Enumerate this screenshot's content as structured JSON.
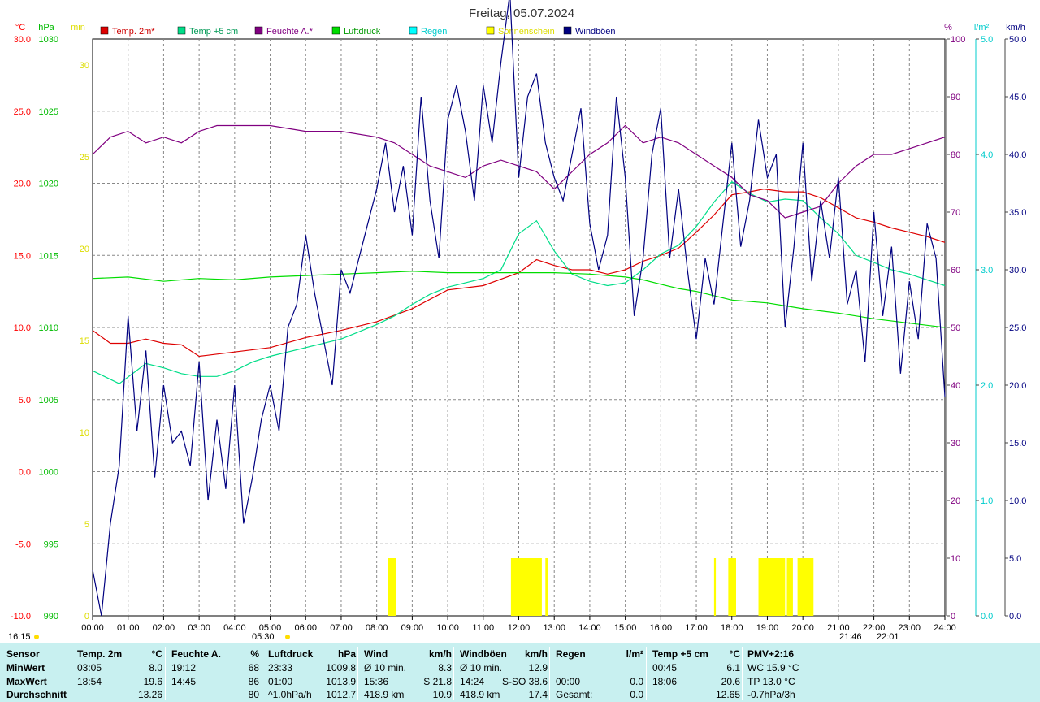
{
  "chart_data": {
    "type": "line",
    "title": "Freitag, 05.07.2024",
    "x_tick_labels": [
      "00:00",
      "01:00",
      "02:00",
      "03:00",
      "04:00",
      "05:00",
      "06:00",
      "07:00",
      "08:00",
      "09:00",
      "10:00",
      "11:00",
      "12:00",
      "13:00",
      "14:00",
      "15:00",
      "16:00",
      "17:00",
      "18:00",
      "19:00",
      "20:00",
      "21:00",
      "22:00",
      "23:00",
      "24:00"
    ],
    "grid": true,
    "axes": {
      "temp": {
        "unit": "°C",
        "color": "#ff0000",
        "range": [
          -10.0,
          30.0
        ],
        "ticks": [
          "30.0",
          "25.0",
          "20.0",
          "15.0",
          "10.0",
          "5.0",
          "0.0",
          "-5.0",
          "-10.0"
        ]
      },
      "pressure": {
        "unit": "hPa",
        "color": "#00bb00",
        "range": [
          990,
          1030
        ],
        "ticks": [
          "1030",
          "1025",
          "1020",
          "1015",
          "1010",
          "1005",
          "1000",
          "995",
          "990"
        ]
      },
      "sun_min": {
        "unit": "min",
        "color": "#dddd00",
        "range": [
          0,
          30
        ],
        "ticks": [
          "30",
          "25",
          "20",
          "15",
          "10",
          "5",
          "0"
        ]
      },
      "humidity": {
        "unit": "%",
        "color": "#800080",
        "range": [
          0,
          100
        ],
        "ticks": [
          "100",
          "90",
          "80",
          "70",
          "60",
          "50",
          "40",
          "30",
          "20",
          "10",
          "0"
        ]
      },
      "rain": {
        "unit": "l/m²",
        "color": "#00cccc",
        "range": [
          0.0,
          5.0
        ],
        "ticks": [
          "5.0",
          "4.0",
          "3.0",
          "2.0",
          "1.0",
          "0.0"
        ]
      },
      "wind": {
        "unit": "km/h",
        "color": "#000080",
        "range": [
          0.0,
          50.0
        ],
        "ticks": [
          "50.0",
          "45.0",
          "40.0",
          "35.0",
          "30.0",
          "25.0",
          "20.0",
          "15.0",
          "10.0",
          "5.0",
          "0.0"
        ]
      }
    },
    "legend": [
      {
        "label": "Temp. 2m*",
        "color": "#dd0000",
        "text_color": "#cc0000"
      },
      {
        "label": "Temp +5 cm",
        "color": "#00dd88",
        "text_color": "#009955"
      },
      {
        "label": "Feuchte A.*",
        "color": "#800080",
        "text_color": "#800080"
      },
      {
        "label": "Luftdruck",
        "color": "#00dd00",
        "text_color": "#009900"
      },
      {
        "label": "Regen",
        "color": "#00ffff",
        "text_color": "#00cccc"
      },
      {
        "label": "Sonnenschein",
        "color": "#ffff00",
        "text_color": "#dddd00"
      },
      {
        "label": "Windböen",
        "color": "#000080",
        "text_color": "#000080"
      }
    ],
    "series": [
      {
        "name": "Temp. 2m*",
        "axis": "temp",
        "color": "#dd0000",
        "x": [
          0,
          0.5,
          1,
          1.5,
          2,
          2.5,
          3,
          4,
          5,
          6,
          7,
          8,
          9,
          10,
          11,
          12,
          12.5,
          13,
          13.5,
          14,
          14.5,
          15,
          15.5,
          16,
          16.5,
          17,
          17.5,
          18,
          18.5,
          18.9,
          19.5,
          20,
          20.5,
          21,
          21.5,
          22,
          22.5,
          23,
          23.5,
          24
        ],
        "y": [
          9.8,
          8.9,
          8.9,
          9.2,
          8.9,
          8.8,
          8.0,
          8.3,
          8.6,
          9.3,
          9.8,
          10.4,
          11.3,
          12.6,
          12.9,
          13.8,
          14.7,
          14.3,
          14.0,
          14.0,
          13.7,
          14.0,
          14.6,
          15.0,
          15.5,
          16.6,
          17.8,
          19.2,
          19.4,
          19.6,
          19.4,
          19.4,
          19.0,
          18.3,
          17.6,
          17.3,
          16.9,
          16.6,
          16.3,
          15.9
        ]
      },
      {
        "name": "Temp +5 cm",
        "axis": "temp",
        "color": "#00dd88",
        "x": [
          0,
          0.75,
          1.5,
          2,
          2.5,
          3,
          3.5,
          4,
          4.5,
          5,
          6,
          7,
          8,
          8.5,
          9,
          9.5,
          10,
          11,
          11.5,
          12,
          12.5,
          13,
          13.5,
          14,
          14.5,
          15,
          15.5,
          16,
          16.5,
          17,
          17.5,
          18,
          18.5,
          19,
          19.5,
          20,
          20.5,
          21,
          21.5,
          22,
          22.5,
          23,
          23.5,
          24
        ],
        "y": [
          7.0,
          6.1,
          7.5,
          7.2,
          6.8,
          6.6,
          6.6,
          7.0,
          7.6,
          8.0,
          8.6,
          9.2,
          10.2,
          10.8,
          11.6,
          12.3,
          12.8,
          13.4,
          14.0,
          16.5,
          17.4,
          15.3,
          13.7,
          13.2,
          12.9,
          13.1,
          14.0,
          15.1,
          15.7,
          17.0,
          18.7,
          20.1,
          19.3,
          18.7,
          18.9,
          18.8,
          17.6,
          16.5,
          15.0,
          14.5,
          14.0,
          13.7,
          13.3,
          12.9
        ]
      },
      {
        "name": "Feuchte A.*",
        "axis": "humidity",
        "color": "#800080",
        "x": [
          0,
          0.5,
          1,
          1.5,
          2,
          2.5,
          3,
          3.5,
          4,
          5,
          6,
          7,
          8,
          8.5,
          9,
          9.5,
          10,
          10.5,
          11,
          11.5,
          12,
          12.5,
          13,
          13.5,
          14,
          14.5,
          15,
          15.5,
          16,
          16.5,
          17,
          17.5,
          18,
          18.5,
          19,
          19.5,
          20,
          20.5,
          21,
          21.5,
          22,
          22.5,
          23,
          23.5,
          24
        ],
        "y": [
          80,
          83,
          84,
          82,
          83,
          82,
          84,
          85,
          85,
          85,
          84,
          84,
          83,
          82,
          80,
          78,
          77,
          76,
          78,
          79,
          78,
          77,
          74,
          77,
          80,
          82,
          85,
          82,
          83,
          82,
          80,
          78,
          76,
          73,
          72,
          69,
          70,
          71,
          75,
          78,
          80,
          80,
          81,
          82,
          83
        ]
      },
      {
        "name": "Luftdruck",
        "axis": "pressure",
        "color": "#00dd00",
        "x": [
          0,
          1,
          2,
          3,
          4,
          5,
          6,
          7,
          8,
          9,
          10,
          11,
          12,
          13,
          14,
          15,
          15.5,
          16,
          16.5,
          17,
          17.5,
          18,
          19,
          20,
          21,
          22,
          23,
          24
        ],
        "y": [
          1013.4,
          1013.5,
          1013.2,
          1013.4,
          1013.3,
          1013.5,
          1013.6,
          1013.7,
          1013.8,
          1013.9,
          1013.8,
          1013.8,
          1013.8,
          1013.8,
          1013.7,
          1013.5,
          1013.3,
          1013.0,
          1012.7,
          1012.5,
          1012.2,
          1011.9,
          1011.7,
          1011.3,
          1011.0,
          1010.6,
          1010.3,
          1010.0
        ]
      }
    ],
    "wind_gusts": {
      "name": "Windböen",
      "axis": "wind",
      "color": "#000080",
      "x": [
        0,
        0.25,
        0.5,
        0.75,
        1,
        1.25,
        1.5,
        1.75,
        2,
        2.25,
        2.5,
        2.75,
        3,
        3.25,
        3.5,
        3.75,
        4,
        4.25,
        4.5,
        4.75,
        5,
        5.25,
        5.5,
        5.75,
        6,
        6.25,
        6.5,
        6.75,
        7,
        7.25,
        7.5,
        7.75,
        8,
        8.25,
        8.5,
        8.75,
        9,
        9.25,
        9.5,
        9.75,
        10,
        10.25,
        10.5,
        10.75,
        11,
        11.25,
        11.5,
        11.75,
        12,
        12.25,
        12.5,
        12.75,
        13,
        13.25,
        13.5,
        13.75,
        14,
        14.25,
        14.5,
        14.75,
        15,
        15.25,
        15.5,
        15.75,
        16,
        16.25,
        16.5,
        16.75,
        17,
        17.25,
        17.5,
        17.75,
        18,
        18.25,
        18.5,
        18.75,
        19,
        19.25,
        19.5,
        19.75,
        20,
        20.25,
        20.5,
        20.75,
        21,
        21.25,
        21.5,
        21.75,
        22,
        22.25,
        22.5,
        22.75,
        23,
        23.25,
        23.5,
        23.75,
        24
      ],
      "y": [
        4,
        0,
        8,
        13,
        26,
        16,
        23,
        12,
        20,
        15,
        16,
        13,
        22,
        10,
        17,
        11,
        20,
        8,
        12,
        17,
        20,
        16,
        25,
        27,
        33,
        28,
        24,
        20,
        30,
        28,
        31,
        34,
        37,
        41,
        35,
        39,
        33,
        45,
        36,
        31,
        43,
        46,
        42,
        36,
        46,
        41,
        48,
        54,
        38,
        45,
        47,
        41,
        38,
        36,
        40,
        44,
        34,
        30,
        33,
        45,
        38,
        26,
        31,
        40,
        44,
        31,
        37,
        30,
        24,
        31,
        27,
        34,
        41,
        32,
        36,
        43,
        38,
        40,
        25,
        32,
        41,
        29,
        36,
        31,
        38,
        27,
        30,
        22,
        35,
        26,
        32,
        21,
        29,
        24,
        34,
        31,
        19,
        38,
        30
      ]
    },
    "sunshine_intervals": [
      [
        8.32,
        8.55
      ],
      [
        11.78,
        12.65
      ],
      [
        12.75,
        12.82
      ],
      [
        17.5,
        17.55
      ],
      [
        17.9,
        18.12
      ],
      [
        18.75,
        19.5
      ],
      [
        19.55,
        19.72
      ],
      [
        19.85,
        20.3
      ]
    ],
    "rain_total": 0.0
  },
  "marks": {
    "time_left": "16:15",
    "moon": "05:30",
    "sunset_pair": "21:46",
    "sunset_right": "22:01"
  },
  "stats": {
    "row_labels": [
      "Sensor",
      "MinWert",
      "MaxWert",
      "Durchschnitt"
    ],
    "columns": [
      {
        "title": "Temp. 2m",
        "unit": "°C",
        "min_time": "03:05",
        "min_val": "8.0",
        "max_time": "18:54",
        "max_val": "19.6",
        "avg_label": "",
        "avg_val": "13.26"
      },
      {
        "title": "Feuchte A.",
        "unit": "%",
        "min_time": "19:12",
        "min_val": "68",
        "max_time": "14:45",
        "max_val": "86",
        "avg_label": "",
        "avg_val": "80"
      },
      {
        "title": "Luftdruck",
        "unit": "hPa",
        "min_time": "23:33",
        "min_val": "1009.8",
        "max_time": "01:00",
        "max_val": "1013.9",
        "avg_label": "^1.0hPa/h",
        "avg_val": "1012.7"
      },
      {
        "title": "Wind",
        "unit": "km/h",
        "min_time": "Ø 10 min.",
        "min_val": "8.3",
        "max_time": "15:36",
        "max_val": "S 21.8",
        "avg_label": "418.9 km",
        "avg_val": "10.9"
      },
      {
        "title": "Windböen",
        "unit": "km/h",
        "min_time": "Ø 10 min.",
        "min_val": "12.9",
        "max_time": "14:24",
        "max_val": "S-SO 38.6",
        "avg_label": "418.9 km",
        "avg_val": "17.4"
      },
      {
        "title": "Regen",
        "unit": "l/m²",
        "min_time": "",
        "min_val": "",
        "max_time": "00:00",
        "max_val": "0.0",
        "avg_label": "Gesamt:",
        "avg_val": "0.0"
      },
      {
        "title": "Temp +5 cm",
        "unit": "°C",
        "min_time": "00:45",
        "min_val": "6.1",
        "max_time": "18:06",
        "max_val": "20.6",
        "avg_label": "",
        "avg_val": "12.65"
      },
      {
        "title": "PMV+2:16",
        "unit": "",
        "min_time": "WC 15.9 °C",
        "min_val": "",
        "max_time": "TP 13.0 °C",
        "max_val": "",
        "avg_label": "-0.7hPa/3h",
        "avg_val": ""
      }
    ]
  }
}
